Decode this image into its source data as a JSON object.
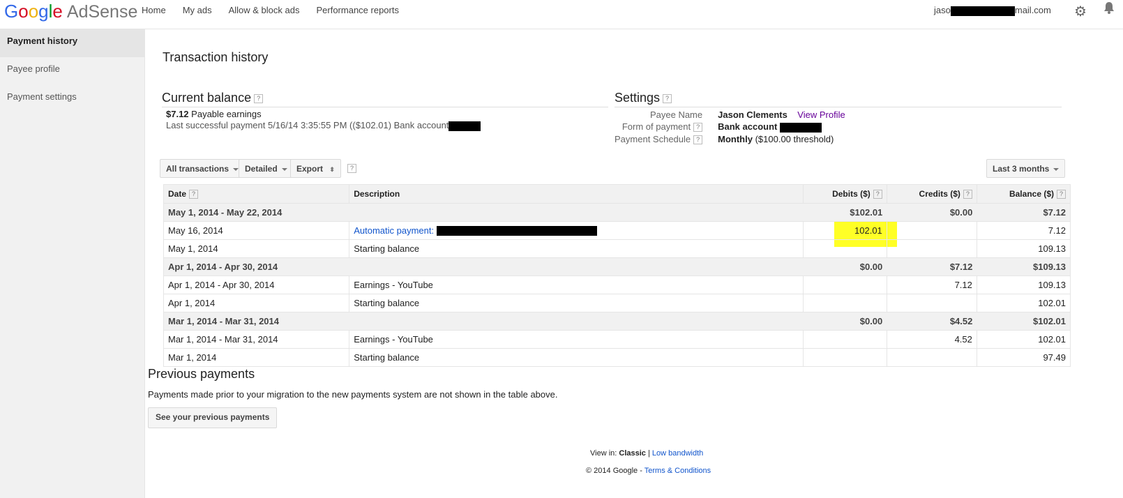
{
  "app": {
    "logo_google": "Google",
    "logo_product": "AdSense"
  },
  "nav": [
    "Home",
    "My ads",
    "Allow & block ads",
    "Performance reports"
  ],
  "account": {
    "prefix": "jaso",
    "suffix": "mail.com"
  },
  "icons": {
    "gear": "gear-icon",
    "bell": "bell-icon"
  },
  "sidebar": {
    "items": [
      {
        "label": "Payment history",
        "active": true
      },
      {
        "label": "Payee profile",
        "active": false
      },
      {
        "label": "Payment settings",
        "active": false
      }
    ]
  },
  "page_title": "Transaction history",
  "current_balance": {
    "title": "Current balance",
    "amount": "$7.12",
    "amount_label": "Payable earnings",
    "last_payment": "Last successful payment 5/16/14 3:35:55 PM (($102.01) Bank account"
  },
  "settings": {
    "title": "Settings",
    "payee_name_label": "Payee Name",
    "payee_name": "Jason Clements",
    "view_profile": "View Profile",
    "form_label": "Form of payment",
    "form_value": "Bank account",
    "schedule_label": "Payment Schedule",
    "schedule_bold": "Monthly",
    "schedule_rest": "($100.00 threshold)"
  },
  "filters": {
    "transactions": "All transactions",
    "detail": "Detailed",
    "export": "Export",
    "range": "Last 3 months"
  },
  "table": {
    "headers": {
      "date": "Date",
      "description": "Description",
      "debits": "Debits ($)",
      "credits": "Credits ($)",
      "balance": "Balance ($)"
    },
    "groups": [
      {
        "period": "May 1, 2014 - May 22, 2014",
        "debits": "$102.01",
        "credits": "$0.00",
        "balance": "$7.12",
        "rows": [
          {
            "date": "May 16, 2014",
            "description": "Automatic payment: ",
            "link": true,
            "debit": "102.01",
            "credit": "",
            "balance": "7.12"
          },
          {
            "date": "May 1, 2014",
            "description": "Starting balance",
            "link": false,
            "debit": "",
            "credit": "",
            "balance": "109.13"
          }
        ]
      },
      {
        "period": "Apr 1, 2014 - Apr 30, 2014",
        "debits": "$0.00",
        "credits": "$7.12",
        "balance": "$109.13",
        "rows": [
          {
            "date": "Apr 1, 2014 - Apr 30, 2014",
            "description": "Earnings - YouTube",
            "link": false,
            "debit": "",
            "credit": "7.12",
            "balance": "109.13"
          },
          {
            "date": "Apr 1, 2014",
            "description": "Starting balance",
            "link": false,
            "debit": "",
            "credit": "",
            "balance": "102.01"
          }
        ]
      },
      {
        "period": "Mar 1, 2014 - Mar 31, 2014",
        "debits": "$0.00",
        "credits": "$4.52",
        "balance": "$102.01",
        "rows": [
          {
            "date": "Mar 1, 2014 - Mar 31, 2014",
            "description": "Earnings - YouTube",
            "link": false,
            "debit": "",
            "credit": "4.52",
            "balance": "102.01"
          },
          {
            "date": "Mar 1, 2014",
            "description": "Starting balance",
            "link": false,
            "debit": "",
            "credit": "",
            "balance": "97.49"
          }
        ]
      }
    ]
  },
  "previous": {
    "title": "Previous payments",
    "text": "Payments made prior to your migration to the new payments system are not shown in the table above.",
    "button": "See your previous payments"
  },
  "footer": {
    "view_in": "View in:",
    "classic": "Classic",
    "sep": "|",
    "low_bandwidth": "Low bandwidth",
    "copyright": "© 2014 Google",
    "dash": "-",
    "terms": "Terms & Conditions"
  },
  "colors": {
    "highlight": "#ffff00",
    "link": "#1155cc",
    "visited_link": "#660099"
  }
}
